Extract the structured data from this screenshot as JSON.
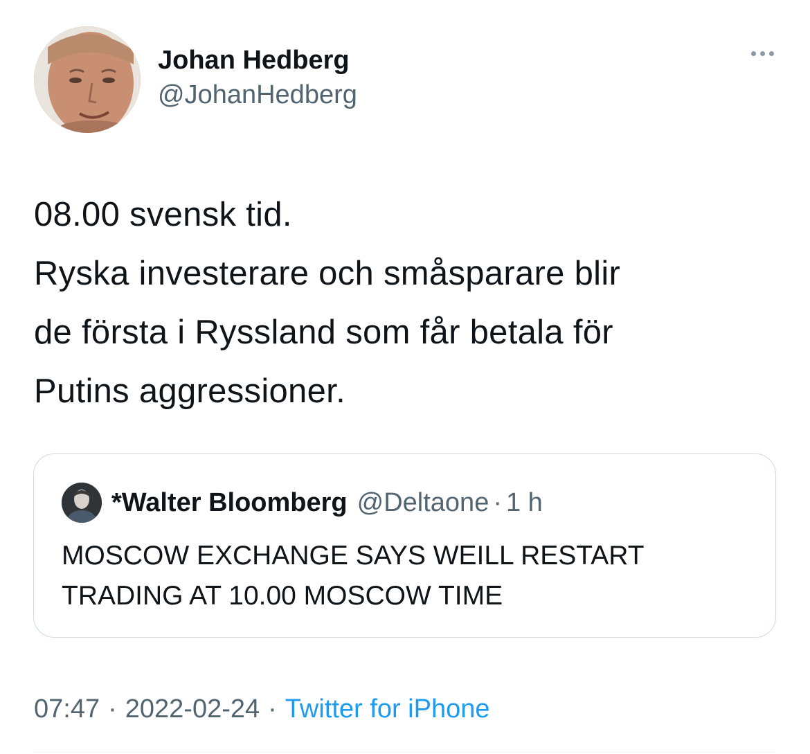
{
  "author": {
    "name": "Johan Hedberg",
    "handle": "@JohanHedberg"
  },
  "more_icon": "more-horizontal-icon",
  "tweet_text": "08.00 svensk tid.\nRyska investerare och småsparare blir\nde första i Ryssland som får betala för\nPutins aggressioner.",
  "quoted_tweet": {
    "name": "*Walter Bloomberg",
    "handle": "@Deltaone",
    "separator": "·",
    "time": "1 h",
    "text": "MOSCOW EXCHANGE SAYS WEILL RESTART\nTRADING AT 10.00 MOSCOW TIME"
  },
  "meta": {
    "time": "07:47",
    "separator": "·",
    "date": "2022-02-24",
    "source": "Twitter for iPhone"
  },
  "colors": {
    "text_primary": "#0f1419",
    "text_secondary": "#536471",
    "link": "#1d9bf0",
    "border": "#cfd9de"
  }
}
